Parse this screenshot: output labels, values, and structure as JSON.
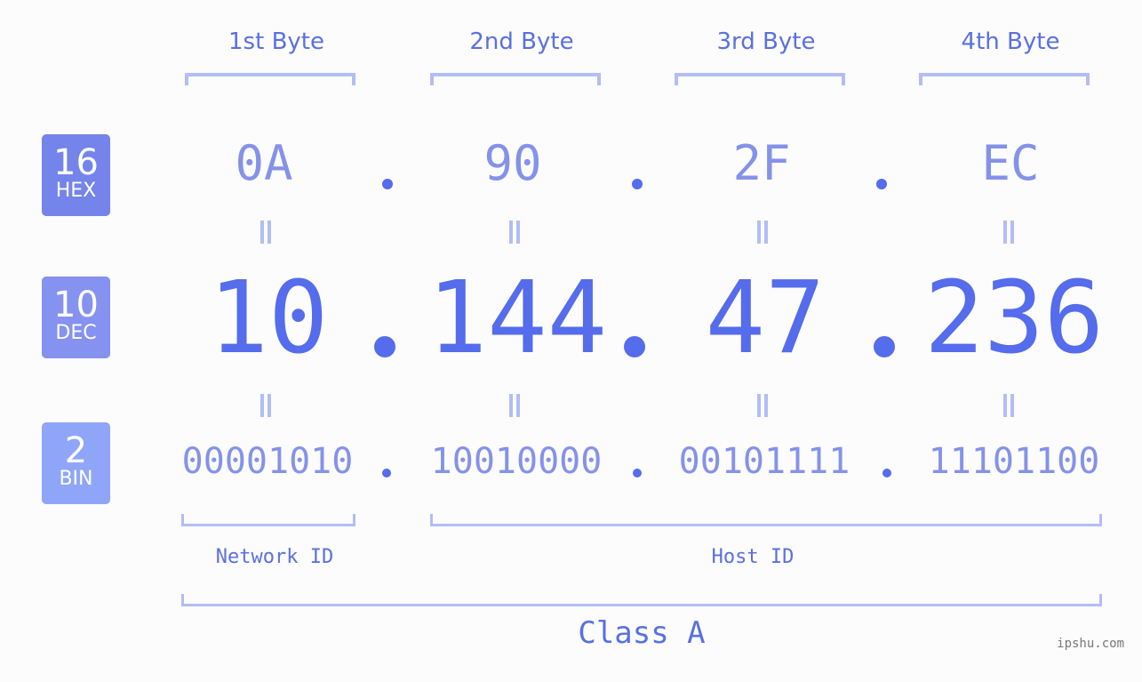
{
  "colors": {
    "accent": "#556cec",
    "hex_badge": "#7484ea",
    "dec_badge": "#8592f0",
    "bin_badge": "#8fa6f8",
    "bracket": "#b3bdf6",
    "light_text": "#8592ea"
  },
  "byte_headers": [
    "1st Byte",
    "2nd Byte",
    "3rd Byte",
    "4th Byte"
  ],
  "badges": {
    "hex": {
      "num": "16",
      "label": "HEX"
    },
    "dec": {
      "num": "10",
      "label": "DEC"
    },
    "bin": {
      "num": "2",
      "label": "BIN"
    }
  },
  "separator": ".",
  "hex_values": [
    "0A",
    "90",
    "2F",
    "EC"
  ],
  "dec_values": [
    "10",
    "144",
    "47",
    "236"
  ],
  "bin_values": [
    "00001010",
    "10010000",
    "00101111",
    "11101100"
  ],
  "sections": {
    "network": "Network ID",
    "host": "Host ID",
    "class": "Class A"
  },
  "watermark": "ipshu.com"
}
